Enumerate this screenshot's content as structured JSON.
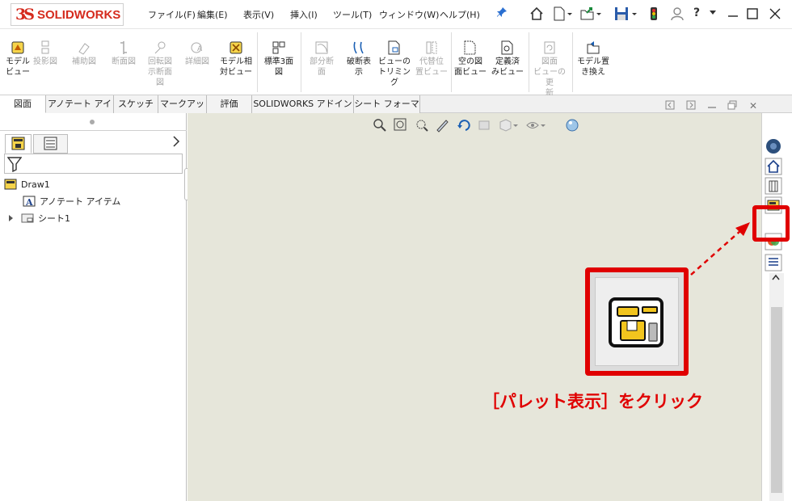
{
  "app": {
    "logo_symbol": "3S",
    "logo_text": "SOLIDWORKS"
  },
  "menu": [
    "ファイル(F)",
    "編集(E)",
    "表示(V)",
    "挿入(I)",
    "ツール(T)",
    "ウィンドウ(W)",
    "ヘルプ(H)"
  ],
  "quick_access": [
    "pin-icon",
    "home-icon",
    "new-document-icon",
    "open-icon",
    "save-icon",
    "traffic-light-icon",
    "user-icon",
    "help-icon"
  ],
  "quick_access_text": {
    "help": "?"
  },
  "ribbon": {
    "tools": [
      {
        "label": "モデル\nビュー",
        "icon": "model-view-icon",
        "enabled": true
      },
      {
        "label": "投影図",
        "icon": "projected-view-icon",
        "enabled": false
      },
      {
        "label": "補助図",
        "icon": "auxiliary-view-icon",
        "enabled": false
      },
      {
        "label": "断面図",
        "icon": "section-view-icon",
        "enabled": false
      },
      {
        "label": "回転図\n示断面\n図",
        "icon": "revolved-section-icon",
        "enabled": false
      },
      {
        "label": "詳細図",
        "icon": "detail-view-icon",
        "enabled": false
      },
      {
        "label": "モデル相\n対ビュー",
        "icon": "relative-view-icon",
        "enabled": true
      },
      {
        "label": "標準3面\n図",
        "icon": "standard-3-view-icon",
        "enabled": true
      },
      {
        "label": "部分断\n面",
        "icon": "broken-out-section-icon",
        "enabled": false
      },
      {
        "label": "破断表\n示",
        "icon": "break-view-icon",
        "enabled": true
      },
      {
        "label": "ビューの\nトリミング",
        "icon": "crop-view-icon",
        "enabled": true
      },
      {
        "label": "代替位\n置ビュー",
        "icon": "alternate-position-icon",
        "enabled": false
      },
      {
        "label": "空の図\n面ビュー",
        "icon": "empty-view-icon",
        "enabled": true
      },
      {
        "label": "定義済\nみビュー",
        "icon": "predefined-view-icon",
        "enabled": true
      },
      {
        "label": "図面\nビューの更\n新",
        "icon": "update-views-icon",
        "enabled": false
      },
      {
        "label": "モデル置\nき換え",
        "icon": "replace-model-icon",
        "enabled": true
      }
    ]
  },
  "tabs": [
    "図面",
    "アノテート アイテム",
    "スケッチ",
    "マークアップ",
    "評価",
    "SOLIDWORKS アドイン",
    "シート フォーマット"
  ],
  "window_controls": [
    "restore-left-icon",
    "restore-right-icon",
    "minimize-icon",
    "maximize-icon",
    "close-icon"
  ],
  "window_controls_text": {
    "close": "✕"
  },
  "feature_tree": {
    "root": "Draw1",
    "items": [
      "アノテート アイテム",
      "シート1"
    ]
  },
  "annotation": {
    "callout_text": "［パレット表示］をクリック",
    "highlight_color": "#e00000"
  }
}
